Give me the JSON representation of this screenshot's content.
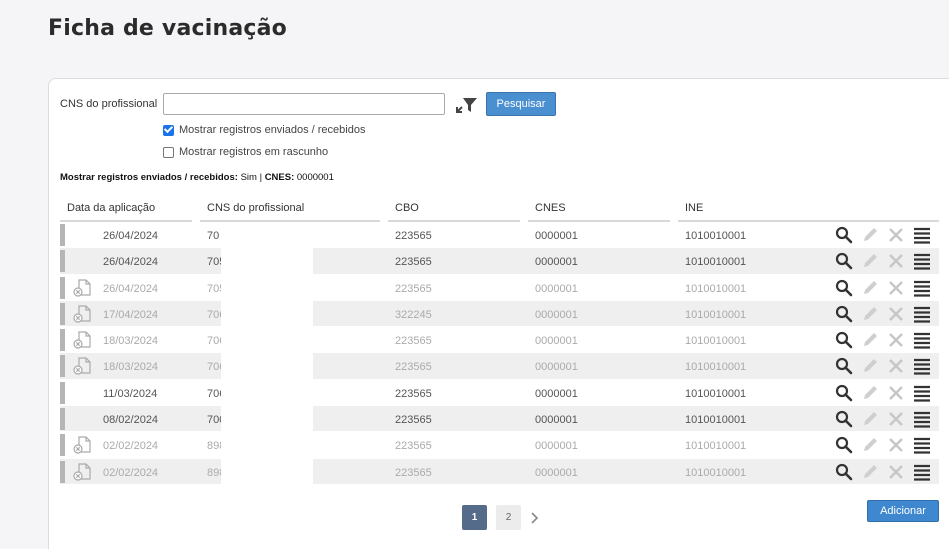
{
  "page": {
    "title": "Ficha de vacinação"
  },
  "filters": {
    "cns_label": "CNS do profissional",
    "cns_value": "",
    "search_button": "Pesquisar",
    "checkbox_sent": {
      "label": "Mostrar registros enviados / recebidos",
      "checked": true
    },
    "checkbox_draft": {
      "label": "Mostrar registros em rascunho",
      "checked": false
    },
    "summary_prefix": "Mostrar registros enviados / recebidos:",
    "summary_sent_value": "Sim",
    "summary_sep": "|",
    "summary_cnes_label": "CNES:",
    "summary_cnes_value": "0000001"
  },
  "table": {
    "columns": [
      "Data da aplicação",
      "CNS do profissional",
      "CBO",
      "CNES",
      "INE"
    ],
    "rows": [
      {
        "date": "26/04/2024",
        "cns": "70",
        "cbo": "223565",
        "cnes": "0000001",
        "ine": "1010010001",
        "doc_icon": false,
        "muted": false
      },
      {
        "date": "26/04/2024",
        "cns": "705",
        "cbo": "223565",
        "cnes": "0000001",
        "ine": "1010010001",
        "doc_icon": false,
        "muted": false
      },
      {
        "date": "26/04/2024",
        "cns": "705",
        "cbo": "223565",
        "cnes": "0000001",
        "ine": "1010010001",
        "doc_icon": true,
        "muted": true
      },
      {
        "date": "17/04/2024",
        "cns": "706",
        "cbo": "322245",
        "cnes": "0000001",
        "ine": "1010010001",
        "doc_icon": true,
        "muted": true
      },
      {
        "date": "18/03/2024",
        "cns": "706",
        "cbo": "223565",
        "cnes": "0000001",
        "ine": "1010010001",
        "doc_icon": true,
        "muted": true
      },
      {
        "date": "18/03/2024",
        "cns": "706",
        "cbo": "223565",
        "cnes": "0000001",
        "ine": "1010010001",
        "doc_icon": true,
        "muted": true
      },
      {
        "date": "11/03/2024",
        "cns": "706",
        "cbo": "223565",
        "cnes": "0000001",
        "ine": "1010010001",
        "doc_icon": false,
        "muted": false
      },
      {
        "date": "08/02/2024",
        "cns": "700",
        "cbo": "223565",
        "cnes": "0000001",
        "ine": "1010010001",
        "doc_icon": false,
        "muted": false
      },
      {
        "date": "02/02/2024",
        "cns": "898",
        "cbo": "223565",
        "cnes": "0000001",
        "ine": "1010010001",
        "doc_icon": true,
        "muted": true
      },
      {
        "date": "02/02/2024",
        "cns": "898",
        "cbo": "223565",
        "cnes": "0000001",
        "ine": "1010010001",
        "doc_icon": true,
        "muted": true
      }
    ],
    "row_actions": [
      "search-icon",
      "edit-icon",
      "delete-icon",
      "menu-icon"
    ]
  },
  "pagination": {
    "pages": [
      "1",
      "2"
    ],
    "current": "1",
    "next_icon": "chevron-right-icon"
  },
  "actions": {
    "add_button": "Adicionar"
  },
  "colors": {
    "primary": "#4a8fd0",
    "pager_active": "#546b8a",
    "row_bar": "#b5b5b5"
  }
}
